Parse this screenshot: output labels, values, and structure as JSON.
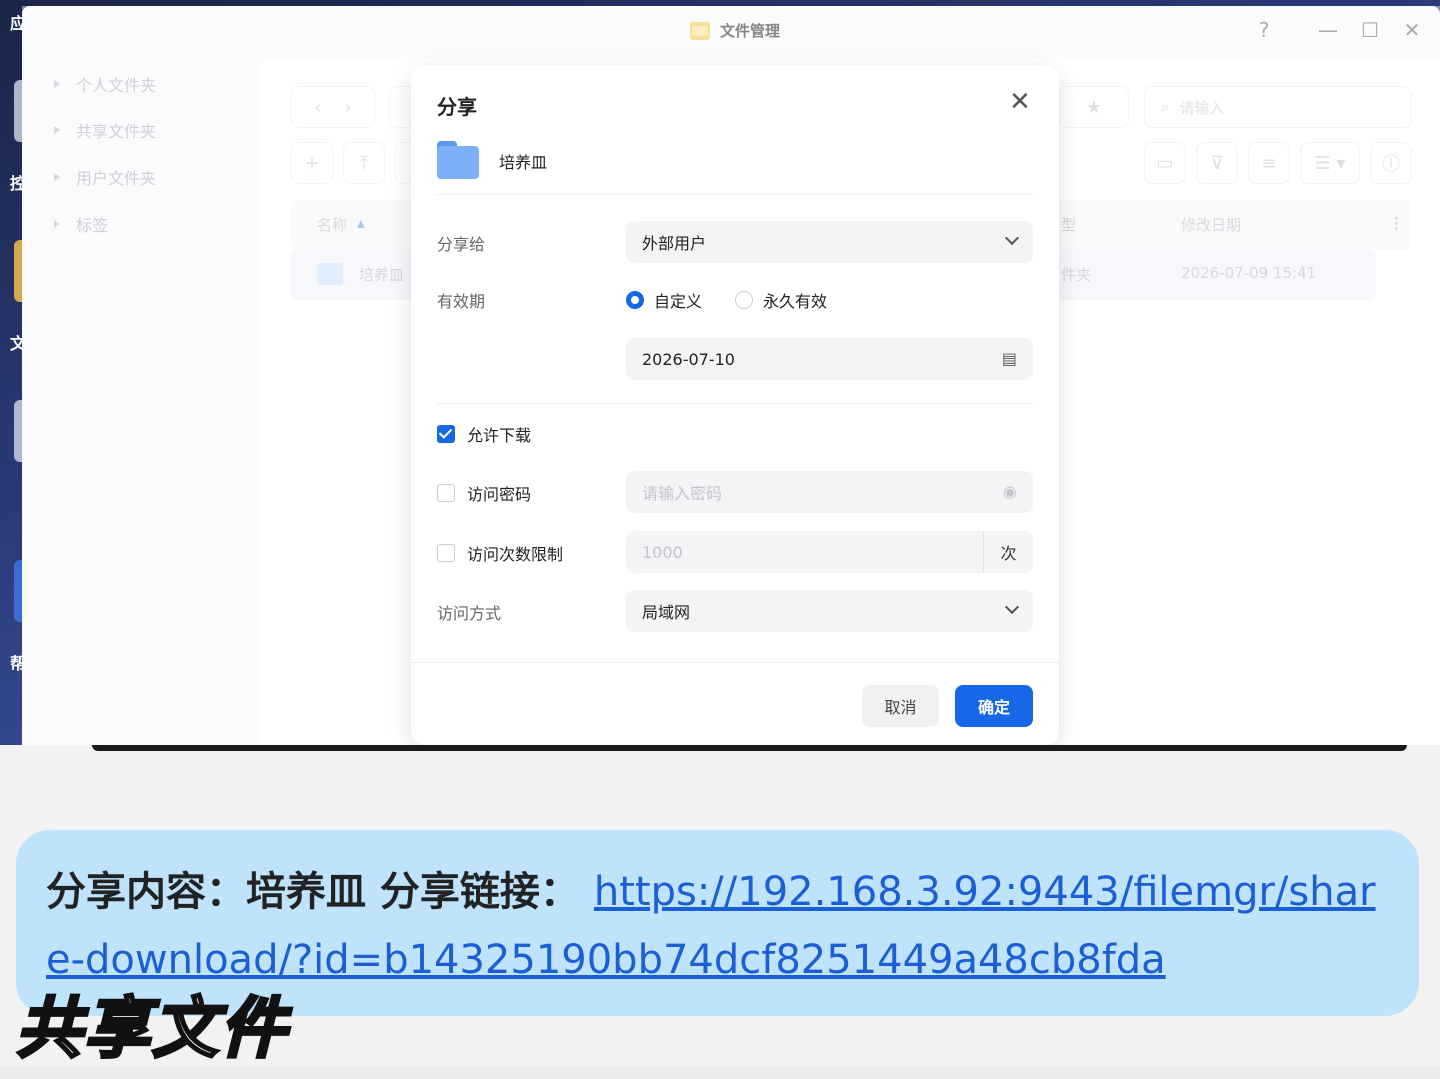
{
  "desktop": {
    "side_letters": [
      "应",
      "控",
      "文",
      "帮"
    ]
  },
  "window": {
    "title": "文件管理",
    "help": "?",
    "minimize": "—",
    "maximize": "☐",
    "close": "✕"
  },
  "sidebar": {
    "items": [
      {
        "label": "个人文件夹"
      },
      {
        "label": "共享文件夹"
      },
      {
        "label": "用户文件夹"
      },
      {
        "label": "标签"
      }
    ]
  },
  "main": {
    "search_placeholder": "请输入",
    "columns": {
      "name": "名称",
      "type_partial": "型",
      "modified": "修改日期"
    },
    "rows": [
      {
        "name": "培养皿",
        "type_partial": "件夹",
        "modified": "2026-07-09 15:41"
      }
    ]
  },
  "dialog": {
    "title": "分享",
    "close": "✕",
    "folder_name": "培养皿",
    "share_to_label": "分享给",
    "share_to_value": "外部用户",
    "validity_label": "有效期",
    "validity_options": [
      {
        "label": "自定义",
        "selected": true
      },
      {
        "label": "永久有效",
        "selected": false
      }
    ],
    "date_value": "2026-07-10",
    "allow_download_label": "允许下载",
    "allow_download_checked": true,
    "password_label": "访问密码",
    "password_placeholder": "请输入密码",
    "limit_label": "访问次数限制",
    "limit_placeholder": "1000",
    "limit_unit": "次",
    "access_label": "访问方式",
    "access_value": "局域网",
    "cancel_label": "取消",
    "ok_label": "确定",
    "accent_color": "#1668e8"
  },
  "caption": {
    "prefix": "分享内容：培养皿 分享链接：",
    "link": "https://192.168.3.92:9443/filemgr/share-download/?id=b14325190bb74dcf8251449a48cb8fda",
    "subtitle": "共享文件"
  }
}
